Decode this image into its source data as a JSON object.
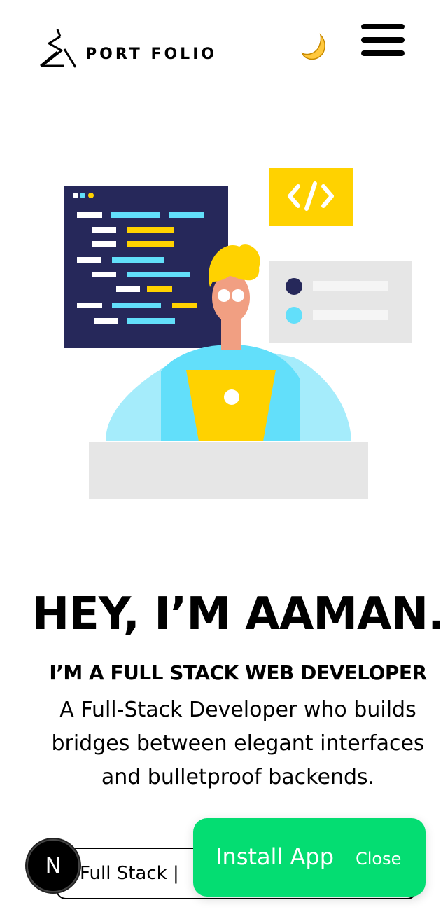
{
  "header": {
    "logo_text": "PORT FOLIO",
    "theme_toggle_icon": "moon-icon",
    "menu_icon": "hamburger-menu-icon"
  },
  "hero": {
    "title": "HEY, I’M AAMAN.",
    "subtitle": "I’M A FULL STACK WEB DEVELOPER",
    "description": "A Full-Stack Developer who builds bridges between elegant interfaces and bulletproof backends.",
    "typing_text": "Full Stack |"
  },
  "dev_badge": {
    "letter": "N"
  },
  "install_prompt": {
    "install_label": "Install App",
    "close_label": "Close"
  },
  "colors": {
    "accent_yellow": "#ffd200",
    "navy": "#26285a",
    "cyan": "#62dffa",
    "install_green": "#04dd72"
  }
}
